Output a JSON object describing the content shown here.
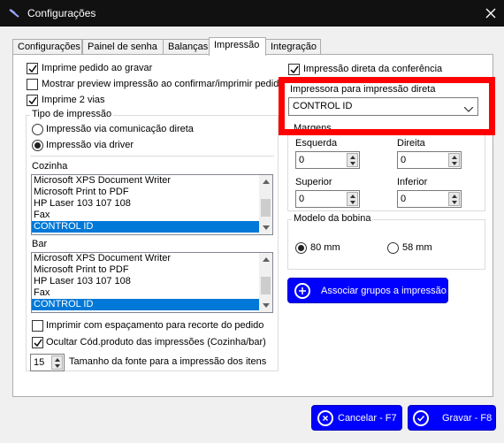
{
  "window": {
    "title": "Configurações"
  },
  "tabs": [
    {
      "label": "Configurações"
    },
    {
      "label": "Painel de senha"
    },
    {
      "label": "Balanças"
    },
    {
      "label": "Impressão"
    },
    {
      "label": "Integração"
    }
  ],
  "left": {
    "options": [
      {
        "label": "Imprime pedido ao gravar",
        "checked": true
      },
      {
        "label": "Mostrar preview impressão ao confirmar/imprimir pedido",
        "checked": false
      },
      {
        "label": "Imprime 2 vias",
        "checked": true
      }
    ],
    "print_type": {
      "title": "Tipo de impressão",
      "options": [
        {
          "label": "Impressão via comunicação direta",
          "selected": false
        },
        {
          "label": "Impressão via driver",
          "selected": true
        }
      ]
    },
    "kitchen": {
      "label": "Cozinha",
      "printers": [
        "Microsoft XPS Document Writer",
        "Microsoft Print to PDF",
        "HP Laser 103 107 108",
        "Fax",
        "CONTROL ID"
      ],
      "selected": "CONTROL ID"
    },
    "bar": {
      "label": "Bar",
      "printers": [
        "Microsoft XPS Document Writer",
        "Microsoft Print to PDF",
        "HP Laser 103 107 108",
        "Fax",
        "CONTROL ID"
      ],
      "selected": "CONTROL ID"
    },
    "bottom_options": [
      {
        "label": "Imprimir com espaçamento para recorte do pedido",
        "checked": false
      },
      {
        "label": "Ocultar Cód.produto das impressões (Cozinha/bar)",
        "checked": true
      }
    ],
    "font_size": {
      "value": "15",
      "label": "Tamanho da fonte para a impressão dos itens"
    }
  },
  "right": {
    "direct_conference": {
      "label": "Impressão direta da conferência",
      "checked": true
    },
    "direct_printer": {
      "label": "Impressora para impressão direta",
      "value": "CONTROL ID"
    },
    "margins": {
      "title": "Margens",
      "left": {
        "label": "Esquerda",
        "value": "0"
      },
      "right": {
        "label": "Direita",
        "value": "0"
      },
      "top": {
        "label": "Superior",
        "value": "0"
      },
      "bottom": {
        "label": "Inferior",
        "value": "0"
      }
    },
    "bobbin": {
      "title": "Modelo da bobina",
      "options": [
        {
          "label": "80 mm",
          "selected": true
        },
        {
          "label": "58 mm",
          "selected": false
        }
      ]
    },
    "assoc_button": {
      "label": "Associar grupos a impressão"
    }
  },
  "footer": {
    "cancel": {
      "label": "Cancelar - F7"
    },
    "save": {
      "label": "Gravar - F8"
    }
  },
  "colors": {
    "button_blue": "#0000ff",
    "selection_blue": "#0078d7",
    "highlight_red": "#ff0000"
  }
}
